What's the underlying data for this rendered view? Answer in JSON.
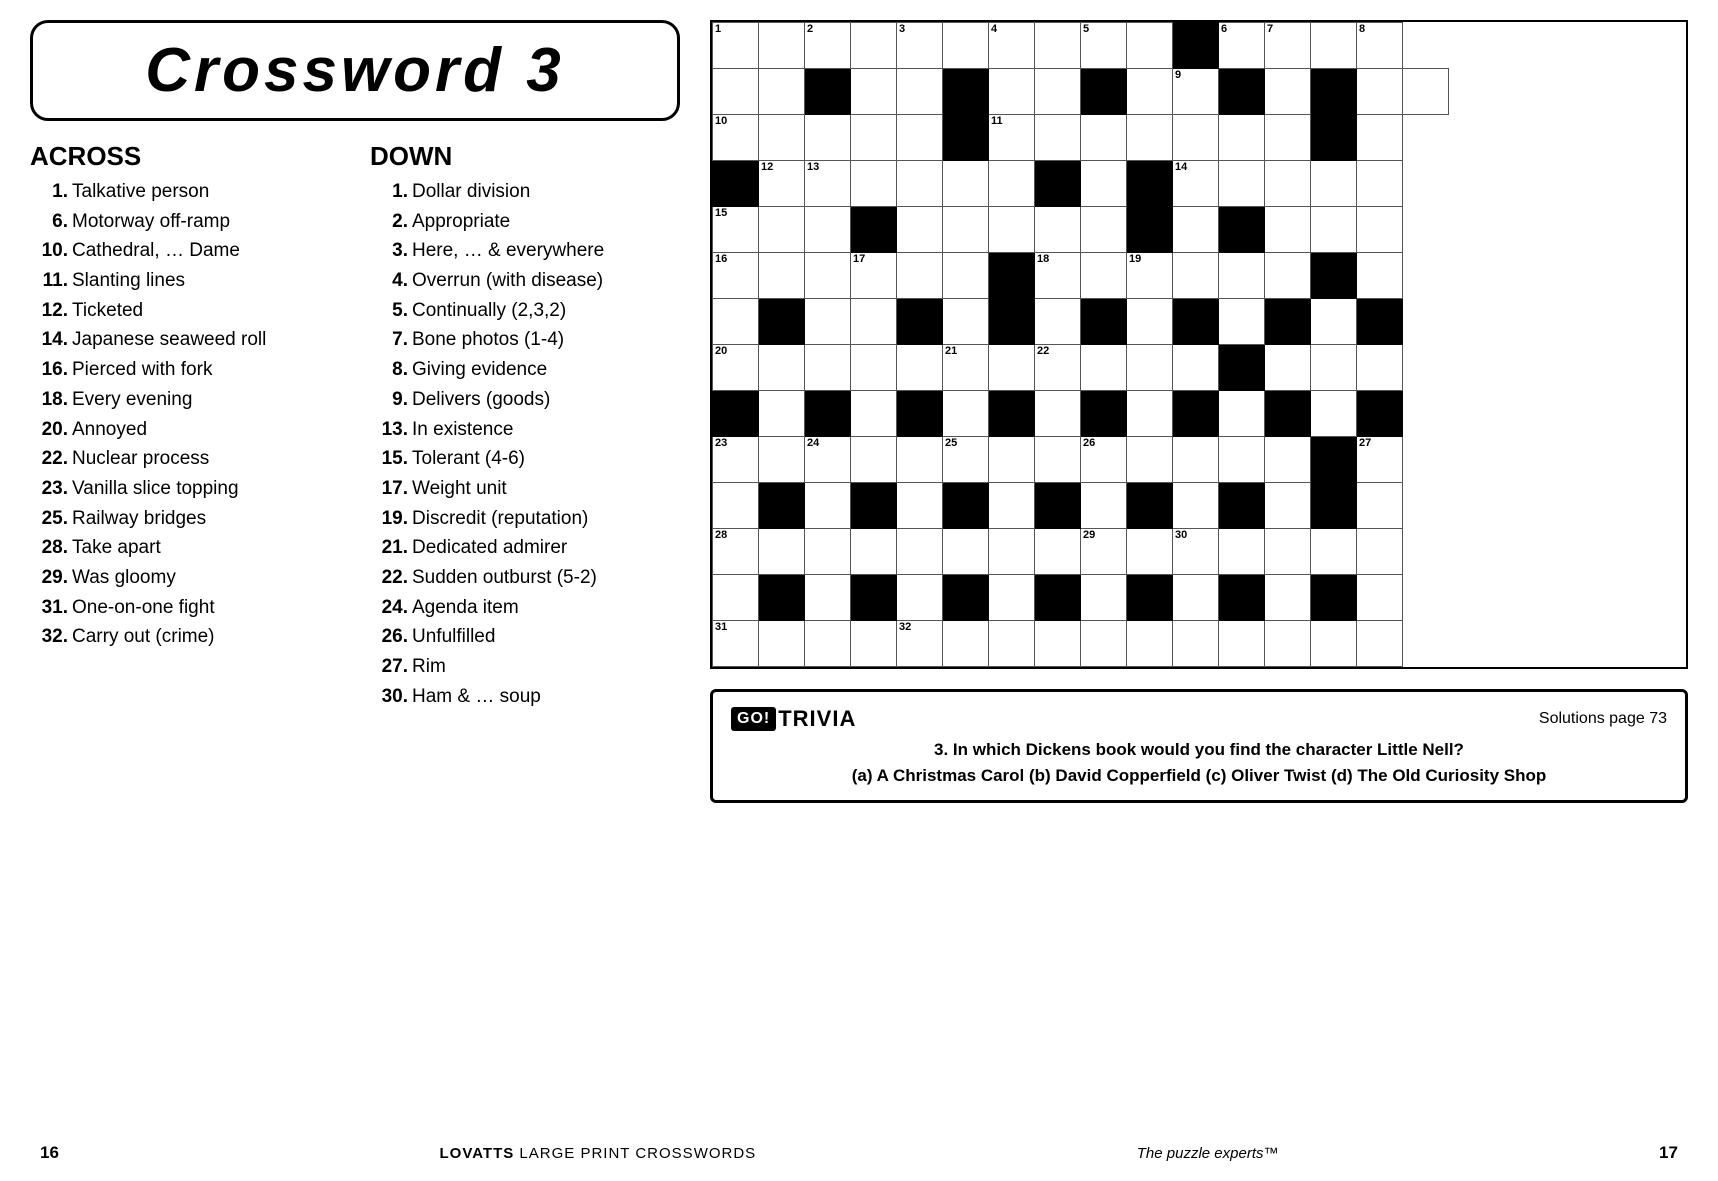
{
  "title": "Crossword   3",
  "across_header": "ACROSS",
  "down_header": "DOWN",
  "across_clues": [
    {
      "num": "1.",
      "text": "Talkative person"
    },
    {
      "num": "6.",
      "text": "Motorway off-ramp"
    },
    {
      "num": "10.",
      "text": "Cathedral, … Dame"
    },
    {
      "num": "11.",
      "text": "Slanting lines"
    },
    {
      "num": "12.",
      "text": "Ticketed"
    },
    {
      "num": "14.",
      "text": "Japanese seaweed roll"
    },
    {
      "num": "16.",
      "text": "Pierced with fork"
    },
    {
      "num": "18.",
      "text": "Every evening"
    },
    {
      "num": "20.",
      "text": "Annoyed"
    },
    {
      "num": "22.",
      "text": "Nuclear process"
    },
    {
      "num": "23.",
      "text": "Vanilla slice topping"
    },
    {
      "num": "25.",
      "text": "Railway bridges"
    },
    {
      "num": "28.",
      "text": "Take apart"
    },
    {
      "num": "29.",
      "text": "Was gloomy"
    },
    {
      "num": "31.",
      "text": "One-on-one fight"
    },
    {
      "num": "32.",
      "text": "Carry out (crime)"
    }
  ],
  "down_clues": [
    {
      "num": "1.",
      "text": "Dollar division"
    },
    {
      "num": "2.",
      "text": "Appropriate"
    },
    {
      "num": "3.",
      "text": "Here, … & everywhere"
    },
    {
      "num": "4.",
      "text": "Overrun (with disease)"
    },
    {
      "num": "5.",
      "text": "Continually (2,3,2)"
    },
    {
      "num": "7.",
      "text": "Bone photos (1-4)"
    },
    {
      "num": "8.",
      "text": "Giving evidence"
    },
    {
      "num": "9.",
      "text": "Delivers (goods)"
    },
    {
      "num": "13.",
      "text": "In existence"
    },
    {
      "num": "15.",
      "text": "Tolerant (4-6)"
    },
    {
      "num": "17.",
      "text": "Weight unit"
    },
    {
      "num": "19.",
      "text": "Discredit (reputation)"
    },
    {
      "num": "21.",
      "text": "Dedicated admirer"
    },
    {
      "num": "22.",
      "text": "Sudden outburst (5-2)"
    },
    {
      "num": "24.",
      "text": "Agenda item"
    },
    {
      "num": "26.",
      "text": "Unfulfilled"
    },
    {
      "num": "27.",
      "text": "Rim"
    },
    {
      "num": "30.",
      "text": "Ham & … soup"
    }
  ],
  "trivia": {
    "logo_box": "GO!",
    "logo_text": "TRIVIA",
    "solutions": "Solutions page 73",
    "question": "3. In which Dickens book would you find the character Little Nell?",
    "options": "(a) A Christmas Carol  (b) David Copperfield  (c) Oliver Twist  (d) The Old Curiosity Shop"
  },
  "footer": {
    "page_left": "16",
    "brand": "LOVATTS",
    "brand_suffix": " LARGE PRINT CROSSWORDS",
    "tagline": "The puzzle experts™",
    "page_right": "17"
  }
}
